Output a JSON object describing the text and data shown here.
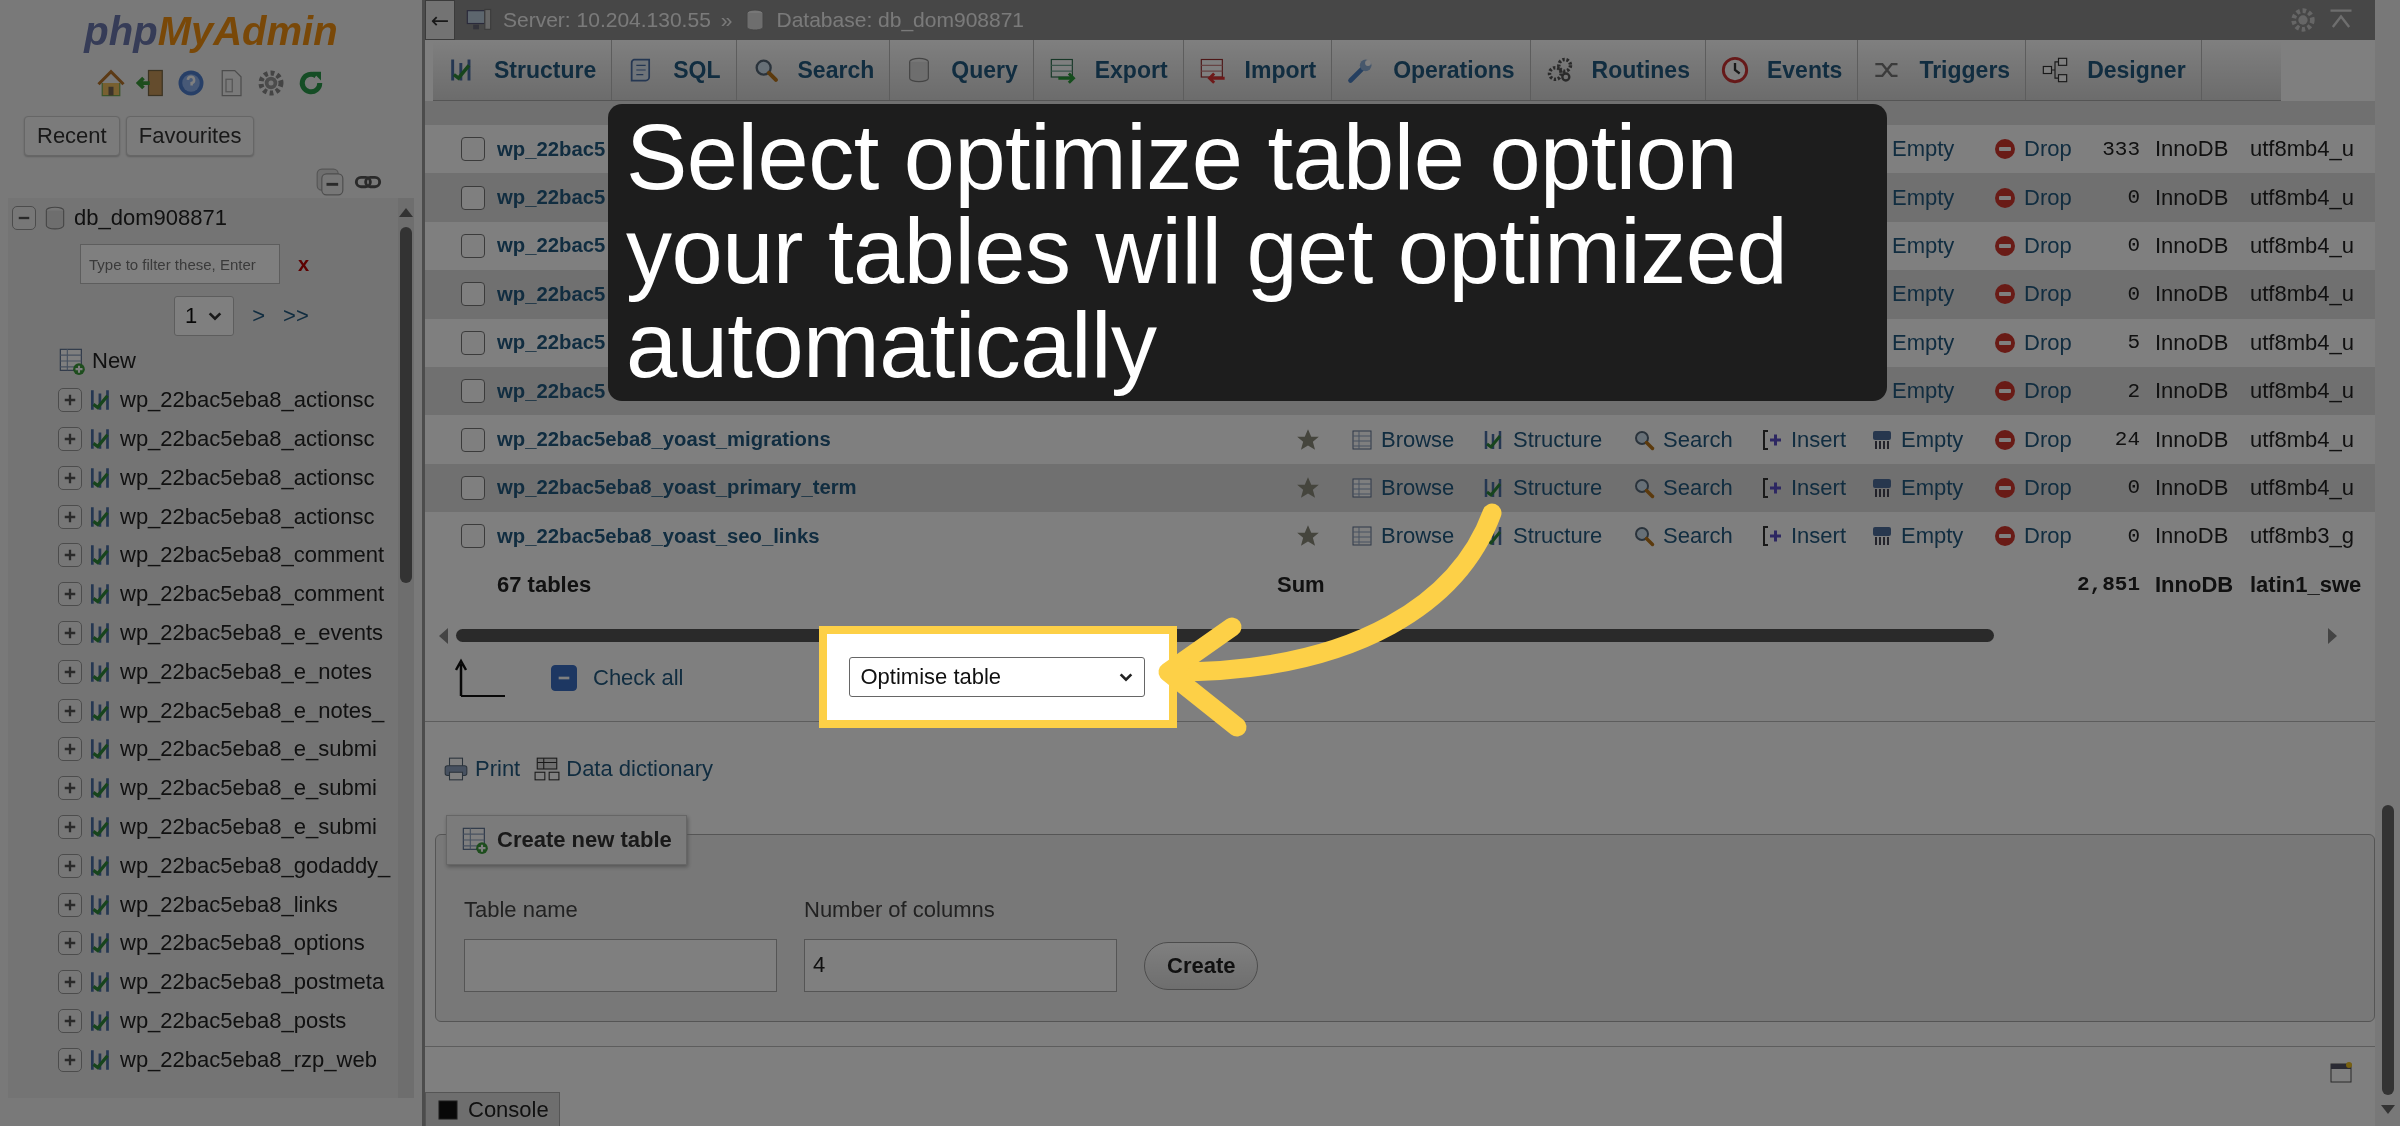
{
  "sidebar": {
    "logo": {
      "left": "php",
      "right": "MyAdmin"
    },
    "buttons": [
      "Recent",
      "Favourites"
    ],
    "database": {
      "name": "db_dom908871",
      "expanded": true
    },
    "filter": {
      "placeholder": "Type to filter these, Enter"
    },
    "clear": "x",
    "pager": {
      "value": "1",
      "links": [
        ">",
        ">>"
      ]
    },
    "new_item": "New",
    "tables": [
      "wp_22bac5eba8_actionsc",
      "wp_22bac5eba8_actionsc",
      "wp_22bac5eba8_actionsc",
      "wp_22bac5eba8_actionsc",
      "wp_22bac5eba8_comment",
      "wp_22bac5eba8_comment",
      "wp_22bac5eba8_e_events",
      "wp_22bac5eba8_e_notes",
      "wp_22bac5eba8_e_notes_",
      "wp_22bac5eba8_e_submi",
      "wp_22bac5eba8_e_submi",
      "wp_22bac5eba8_e_submi",
      "wp_22bac5eba8_godaddy_",
      "wp_22bac5eba8_links",
      "wp_22bac5eba8_options",
      "wp_22bac5eba8_postmeta",
      "wp_22bac5eba8_posts",
      "wp_22bac5eba8_rzp_web"
    ]
  },
  "breadcrumb": {
    "back": "←",
    "server": "Server: 10.204.130.55",
    "separator": "»",
    "database": "Database: db_dom908871"
  },
  "tabs": [
    "Structure",
    "SQL",
    "Search",
    "Query",
    "Export",
    "Import",
    "Operations",
    "Routines",
    "Events",
    "Triggers",
    "Designer"
  ],
  "table": {
    "rows": [
      {
        "kind": "covered",
        "checked": false,
        "name": "wp_22bac5",
        "actions": [
          {
            "kind": "empty",
            "label": "Empty"
          },
          {
            "kind": "drop",
            "label": "Drop"
          }
        ],
        "rows": "333",
        "engine": "InnoDB",
        "collation": "utf8mb4_u"
      },
      {
        "kind": "covered",
        "checked": false,
        "name": "wp_22bac5",
        "actions": [
          {
            "kind": "empty",
            "label": "Empty"
          },
          {
            "kind": "drop",
            "label": "Drop"
          }
        ],
        "rows": "0",
        "engine": "InnoDB",
        "collation": "utf8mb4_u"
      },
      {
        "kind": "covered",
        "checked": false,
        "name": "wp_22bac5",
        "actions": [
          {
            "kind": "empty",
            "label": "Empty"
          },
          {
            "kind": "drop",
            "label": "Drop"
          }
        ],
        "rows": "0",
        "engine": "InnoDB",
        "collation": "utf8mb4_u"
      },
      {
        "kind": "covered",
        "checked": false,
        "name": "wp_22bac5",
        "actions": [
          {
            "kind": "empty",
            "label": "Empty"
          },
          {
            "kind": "drop",
            "label": "Drop"
          }
        ],
        "rows": "0",
        "engine": "InnoDB",
        "collation": "utf8mb4_u"
      },
      {
        "kind": "covered",
        "checked": false,
        "name": "wp_22bac5",
        "actions": [
          {
            "kind": "empty",
            "label": "Empty"
          },
          {
            "kind": "drop",
            "label": "Drop"
          }
        ],
        "rows": "5",
        "engine": "InnoDB",
        "collation": "utf8mb4_u"
      },
      {
        "kind": "covered",
        "checked": false,
        "name": "wp_22bac5",
        "actions": [
          {
            "kind": "empty",
            "label": "Empty"
          },
          {
            "kind": "drop",
            "label": "Drop"
          }
        ],
        "rows": "2",
        "engine": "InnoDB",
        "collation": "utf8mb4_u"
      },
      {
        "kind": "plain",
        "checked": false,
        "name": "wp_22bac5eba8_yoast_migrations",
        "favorite": false,
        "actions": [
          {
            "kind": "browse",
            "label": "Browse"
          },
          {
            "kind": "structure",
            "label": "Structure"
          },
          {
            "kind": "search",
            "label": "Search"
          },
          {
            "kind": "insert",
            "label": "Insert"
          },
          {
            "kind": "empty",
            "label": "Empty"
          },
          {
            "kind": "drop",
            "label": "Drop"
          }
        ],
        "rows": "24",
        "engine": "InnoDB",
        "collation": "utf8mb4_u"
      },
      {
        "kind": "plain",
        "checked": false,
        "name": "wp_22bac5eba8_yoast_primary_term",
        "favorite": false,
        "actions": [
          {
            "kind": "browse",
            "label": "Browse"
          },
          {
            "kind": "structure",
            "label": "Structure"
          },
          {
            "kind": "search",
            "label": "Search"
          },
          {
            "kind": "insert",
            "label": "Insert"
          },
          {
            "kind": "empty",
            "label": "Empty"
          },
          {
            "kind": "drop",
            "label": "Drop"
          }
        ],
        "rows": "0",
        "engine": "InnoDB",
        "collation": "utf8mb4_u"
      },
      {
        "kind": "plain",
        "checked": false,
        "name": "wp_22bac5eba8_yoast_seo_links",
        "favorite": false,
        "actions": [
          {
            "kind": "browse",
            "label": "Browse"
          },
          {
            "kind": "structure",
            "label": "Structure"
          },
          {
            "kind": "search",
            "label": "Search"
          },
          {
            "kind": "insert",
            "label": "Insert"
          },
          {
            "kind": "empty",
            "label": "Empty"
          },
          {
            "kind": "drop",
            "label": "Drop"
          }
        ],
        "rows": "0",
        "engine": "InnoDB",
        "collation": "utf8mb3_g"
      }
    ],
    "summary": {
      "label": "67 tables",
      "sum": "Sum",
      "rows": "2,851",
      "engine": "InnoDB",
      "collation": "latin1_swe"
    }
  },
  "bulk": {
    "check_all": {
      "label": "Check all",
      "indeterminate": true
    },
    "with_selected": {
      "value": "Optimise table"
    }
  },
  "links": [
    "Print",
    "Data dictionary"
  ],
  "create_table": {
    "legend": "Create new table",
    "fields": [
      {
        "label": "Table name"
      },
      {
        "label": "Number of columns",
        "value": "4"
      }
    ],
    "button": "Create"
  },
  "console": "Console",
  "callout": {
    "text": "Select optimize table option your tables will get optimized automatically"
  }
}
